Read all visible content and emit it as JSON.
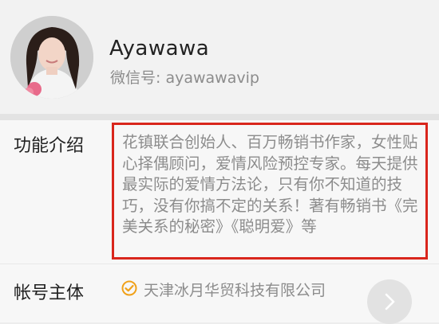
{
  "profile": {
    "name": "Ayawawa",
    "wechat_id": "微信号: ayawawavip",
    "avatar": "avatar-photo"
  },
  "intro": {
    "label": "功能介绍",
    "description": "花镇联合创始人、百万畅销书作家，女性贴心择偶顾问，爱情风险预控专家。每天提供最实际的爱情方法论，只有你不知道的技巧，没有你搞不定的关系！著有畅销书《完美关系的秘密》《聪明爱》等"
  },
  "account": {
    "label": "帐号主体",
    "company": "天津冰月华贸科技有限公司",
    "verified_icon": "check-circle-icon",
    "verified_color": "#f0a11a"
  },
  "highlight_color": "#d9261c",
  "next_icon": "chevron-right-icon"
}
